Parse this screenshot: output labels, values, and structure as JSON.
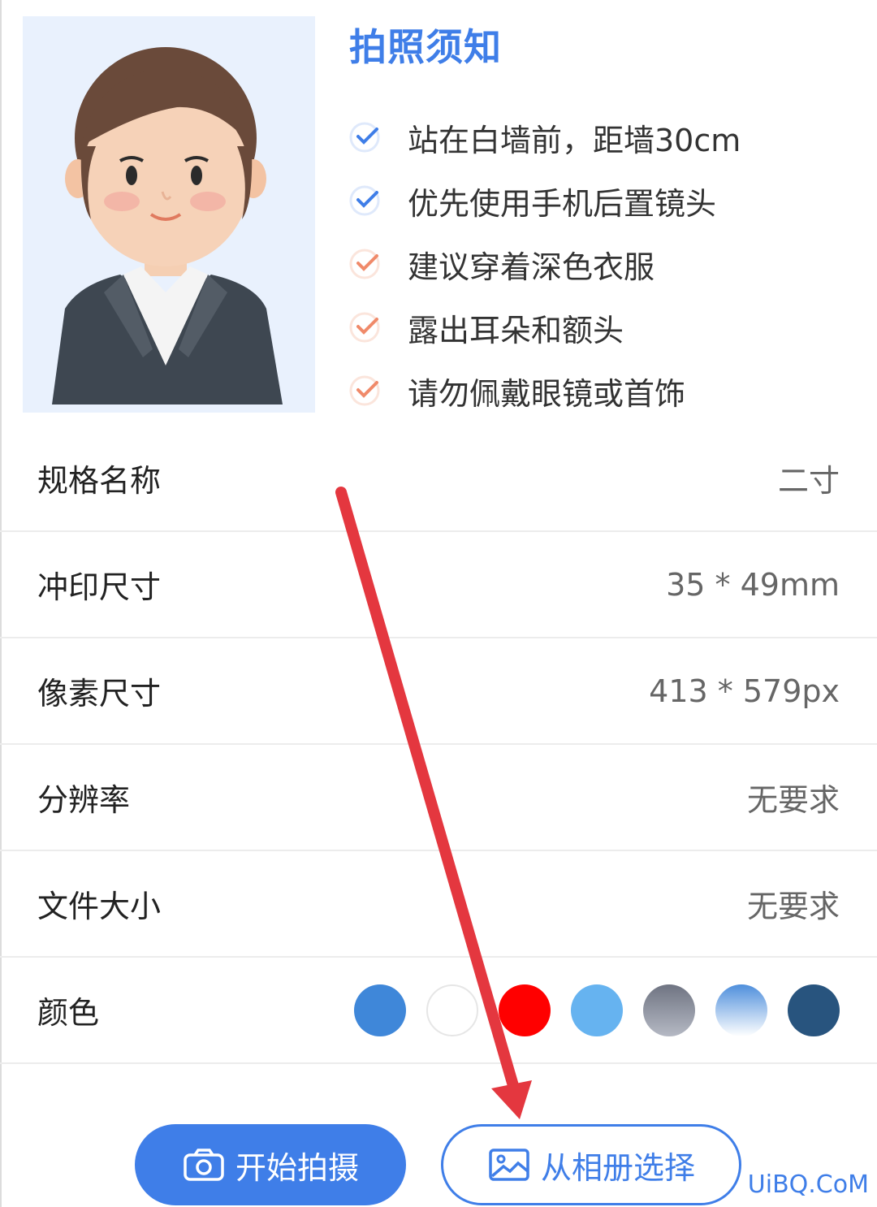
{
  "tips": {
    "title": "拍照须知",
    "items": [
      {
        "text": "站在白墙前，距墙30cm",
        "tone": "blue"
      },
      {
        "text": "优先使用手机后置镜头",
        "tone": "blue"
      },
      {
        "text": "建议穿着深色衣服",
        "tone": "orange"
      },
      {
        "text": "露出耳朵和额头",
        "tone": "orange"
      },
      {
        "text": "请勿佩戴眼镜或首饰",
        "tone": "orange"
      }
    ]
  },
  "specs": {
    "name": {
      "label": "规格名称",
      "value": "二寸"
    },
    "print_size": {
      "label": "冲印尺寸",
      "value": "35 * 49mm"
    },
    "pixel_size": {
      "label": "像素尺寸",
      "value": "413 * 579px"
    },
    "resolution": {
      "label": "分辨率",
      "value": "无要求"
    },
    "file_size": {
      "label": "文件大小",
      "value": "无要求"
    },
    "color": {
      "label": "颜色"
    }
  },
  "colors": [
    "#3f87d9",
    "#ffffff",
    "#ff0000",
    "#66b3f0",
    "gradient-gray",
    "gradient-blue",
    "#28547e"
  ],
  "buttons": {
    "shoot": "开始拍摄",
    "album": "从相册选择"
  },
  "watermark": "UiBQ.CoM",
  "icons": {
    "check": "check-circle-icon",
    "camera": "camera-icon",
    "gallery": "image-icon"
  }
}
